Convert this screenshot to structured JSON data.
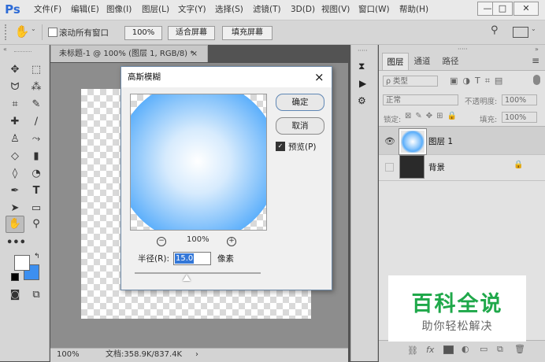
{
  "app": {
    "logo": "Ps"
  },
  "menubar": {
    "items": [
      "文件(F)",
      "编辑(E)",
      "图像(I)",
      "图层(L)",
      "文字(Y)",
      "选择(S)",
      "滤镜(T)",
      "3D(D)",
      "视图(V)",
      "窗口(W)",
      "帮助(H)"
    ]
  },
  "window_controls": {
    "minimize": "—",
    "maximize": "□",
    "close": "✕"
  },
  "options": {
    "hand_icon": "hand-icon",
    "scroll_all_label": "滚动所有窗口",
    "zoom_button": "100%",
    "fit_screen": "适合屏幕",
    "fill_screen": "填充屏幕"
  },
  "document": {
    "tab_title": "未标题-1 @ 100% (图层 1, RGB/8) *",
    "tab_close": "×",
    "status_zoom": "100%",
    "status_doc": "文档:358.9K/837.4K",
    "status_arrow": "›"
  },
  "dialog": {
    "title": "高斯模糊",
    "close": "×",
    "ok": "确定",
    "cancel": "取消",
    "preview_label": "预览(P)",
    "preview_checked": true,
    "zoom_out": "−",
    "zoom_level": "100%",
    "zoom_in": "+",
    "radius_label": "半径(R):",
    "radius_value": "15.0",
    "radius_unit": "像素",
    "blur_color": "#5aaefb"
  },
  "layers_panel": {
    "tabs": [
      "图层",
      "通道",
      "路径"
    ],
    "filter_kind": "ρ 类型",
    "blend_mode": "正常",
    "opacity_label": "不透明度:",
    "opacity_value": "100%",
    "lock_label": "锁定:",
    "fill_label": "填充:",
    "fill_value": "100%",
    "layers": [
      {
        "name": "图层 1",
        "visible": true,
        "selected": true
      },
      {
        "name": "背景",
        "visible": false,
        "locked": true
      }
    ],
    "bottom_icons": [
      "link-icon",
      "fx-icon",
      "mask-icon",
      "adjustment-icon",
      "group-icon",
      "new-layer-icon",
      "delete-icon"
    ],
    "bottom_fx": "fx"
  },
  "watermark": {
    "title": "百科全说",
    "subtitle": "助你轻松解决",
    "title_color": "#1fa84a"
  }
}
